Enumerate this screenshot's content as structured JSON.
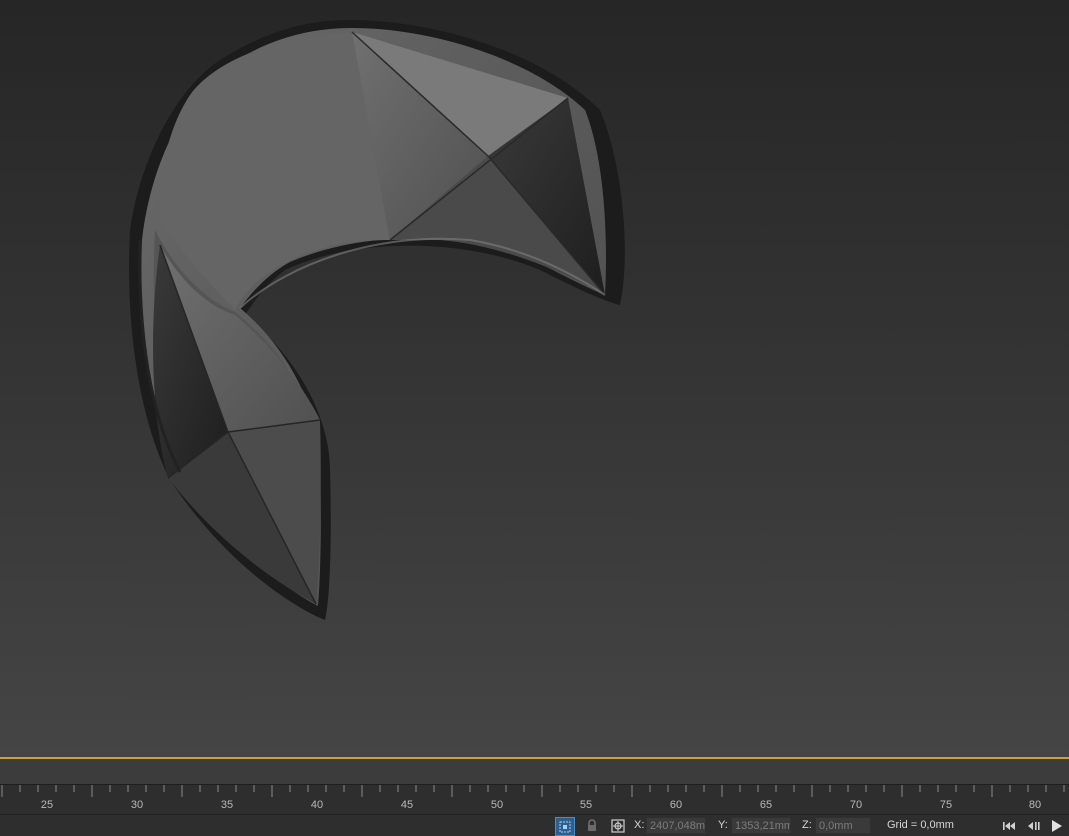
{
  "viewport": {
    "model_icon": "bracelet-3d-model"
  },
  "timeline": {
    "ticks": [
      "25",
      "30",
      "35",
      "40",
      "45",
      "50",
      "55",
      "60",
      "65",
      "70",
      "75",
      "80"
    ]
  },
  "status": {
    "isolate_icon": "isolate-selection-icon",
    "lock_icon": "lock-icon",
    "transform_icon": "transform-type-in-icon",
    "x_label": "X:",
    "x_value": "2407,048m",
    "y_label": "Y:",
    "y_value": "1353,21mm",
    "z_label": "Z:",
    "z_value": "0,0mm",
    "grid_text": "Grid = 0,0mm"
  },
  "colors": {
    "accent": "#c9a23a",
    "isolate_blue": "#3f8fd6"
  }
}
